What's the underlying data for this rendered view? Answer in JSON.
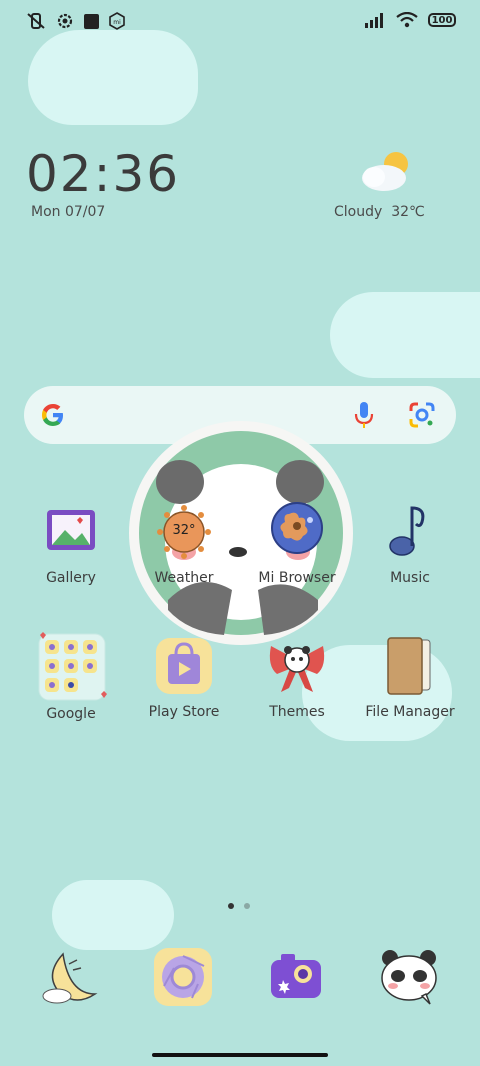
{
  "status_bar": {
    "battery": "100",
    "left_icons": [
      "mute-vibrate-icon",
      "settings-gear-icon",
      "square-notification-icon",
      "mi-icon"
    ],
    "right_icons": [
      "signal-icon",
      "wifi-icon",
      "battery-icon"
    ]
  },
  "clock_widget": {
    "time": "02:36",
    "date": "Mon 07/07",
    "weather": "Cloudy",
    "temperature": "32℃"
  },
  "search": {
    "google_icon": "google-g-icon",
    "mic_icon": "mic-icon",
    "lens_icon": "google-lens-icon"
  },
  "apps_row1": [
    {
      "label": "Gallery",
      "icon": "gallery-icon"
    },
    {
      "label": "Weather",
      "icon": "weather-icon",
      "badge": "32°"
    },
    {
      "label": "Mi Browser",
      "icon": "browser-icon"
    },
    {
      "label": "Music",
      "icon": "music-note-icon"
    }
  ],
  "apps_row2": [
    {
      "label": "Google",
      "icon": "google-folder-icon"
    },
    {
      "label": "Play Store",
      "icon": "play-store-icon"
    },
    {
      "label": "Themes",
      "icon": "themes-panda-bow-icon"
    },
    {
      "label": "File Manager",
      "icon": "file-manager-icon"
    }
  ],
  "dock": [
    {
      "icon": "moon-icon"
    },
    {
      "icon": "chrome-icon"
    },
    {
      "icon": "camera-icon"
    },
    {
      "icon": "panda-messages-icon"
    }
  ],
  "page_indicator": {
    "pages": 2,
    "current": 1
  },
  "colors": {
    "background": "#b4e3dc",
    "cloud": "#d8f6f3",
    "text": "#3d3d3d"
  }
}
